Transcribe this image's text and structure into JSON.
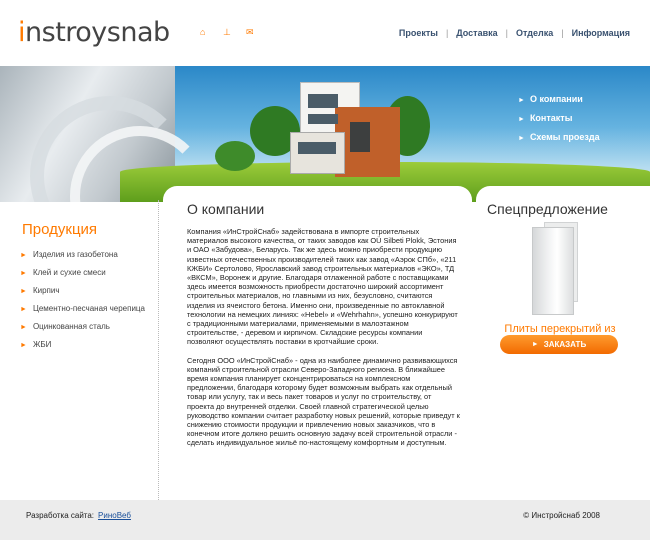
{
  "header": {
    "logo_first": "i",
    "logo_rest": "nstroysnab",
    "icons": [
      "home-icon",
      "sitemap-icon",
      "mail-icon"
    ],
    "nav": [
      "Проекты",
      "Доставка",
      "Отделка",
      "Информация"
    ]
  },
  "banner": {
    "menu": [
      "О компании",
      "Контакты",
      "Схемы проезда"
    ]
  },
  "products": {
    "title": "Продукция",
    "items": [
      "Изделия из газобетона",
      "Клей и сухие смеси",
      "Кирпич",
      "Цементно-песчаная черепица",
      "Оцинкованная сталь",
      "ЖБИ"
    ]
  },
  "about": {
    "title": "О компании",
    "p1": "Компания «ИнСтройСнаб» задействована в импорте строительных материалов высокого качества, от таких заводов как OÜ Silbeti Plokk, Эстония и ОАО «Забудова», Беларусь. Так же здесь можно приобрести продукцию известных отечественных производителей таких как завод «Аэрок СПб», «211 КЖБИ» Сертолово, Ярославский завод строительных материалов «ЭКО», ТД «ВКСМ», Воронеж и другие. Благодаря отлаженной работе с поставщиками здесь имеется возможность приобрести достаточно широкий ассортимент строительных материалов, но главными из них, безусловно, считаются изделия из ячеистого бетона. Именно они, произведенные по автоклавной технологии на немецких линиях: «Hebel» и «Wehrhahn», успешно конкурируют с традиционными материалами, применяемыми в малоэтажном строительстве, - деревом и кирпичом. Складские ресурсы компании позволяют осуществлять поставки в кротчайшие сроки.",
    "p2": "Сегодня ООО «ИнСтройСнаб» - одна из наиболее динамично развивающихся компаний строительной отрасли Северо-Западного региона. В ближайшее время компания планирует сконцентрироваться на комплексном предложении, благодаря которому будет возможным выбрать как отдельный товар или услугу, так и весь пакет товаров и услуг по строительству, от проекта до внутренней отделки. Своей главной стратегической целью руководство компании считает разработку новых решений, которые приведут к снижению стоимости продукции и привлечению новых заказчиков, что в конечном итоге должно решить основную задачу всей строительной отрасли - сделать индивидуальное жильё по-настоящему комфортным и доступным."
  },
  "special": {
    "title": "Спецпредложение",
    "desc": "Плиты перекрытий из ячеистого бетона",
    "button": "ЗАКАЗАТЬ"
  },
  "footer": {
    "dev_label": "Разработка сайта:",
    "dev_link": "РиноВеб",
    "copyright": "© Инстройснаб 2008"
  },
  "colors": {
    "accent": "#ff7a00",
    "nav_text": "#3a5270",
    "link": "#1a4f9a"
  }
}
